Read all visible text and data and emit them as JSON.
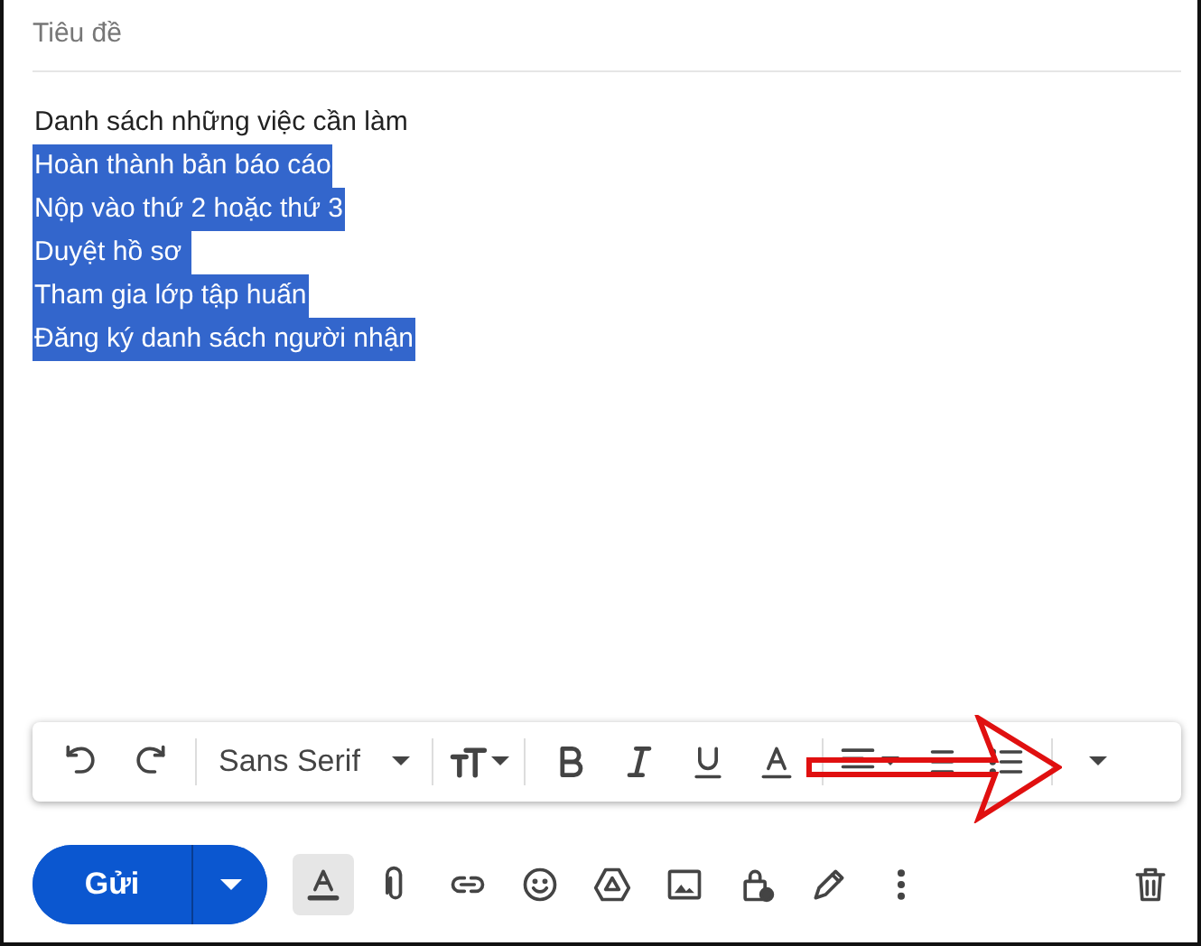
{
  "subject": {
    "placeholder": "Tiêu đề"
  },
  "body": {
    "lines": [
      {
        "text": "Danh sách những việc cần làm",
        "selected": false
      },
      {
        "text": "Hoàn thành bản báo cáo",
        "selected": true
      },
      {
        "text": "Nộp vào thứ 2 hoặc thứ 3",
        "selected": true
      },
      {
        "text": "Duyệt hồ sơ ",
        "selected": true
      },
      {
        "text": "Tham gia lớp tập huấn",
        "selected": true
      },
      {
        "text": "Đăng ký danh sách người nhận",
        "selected": true
      }
    ]
  },
  "format_toolbar": {
    "font": "Sans Serif"
  },
  "bottom_bar": {
    "send_label": "Gửi",
    "formatting_toggle": {
      "selected": true
    }
  },
  "annotation": {
    "kind": "arrow"
  }
}
